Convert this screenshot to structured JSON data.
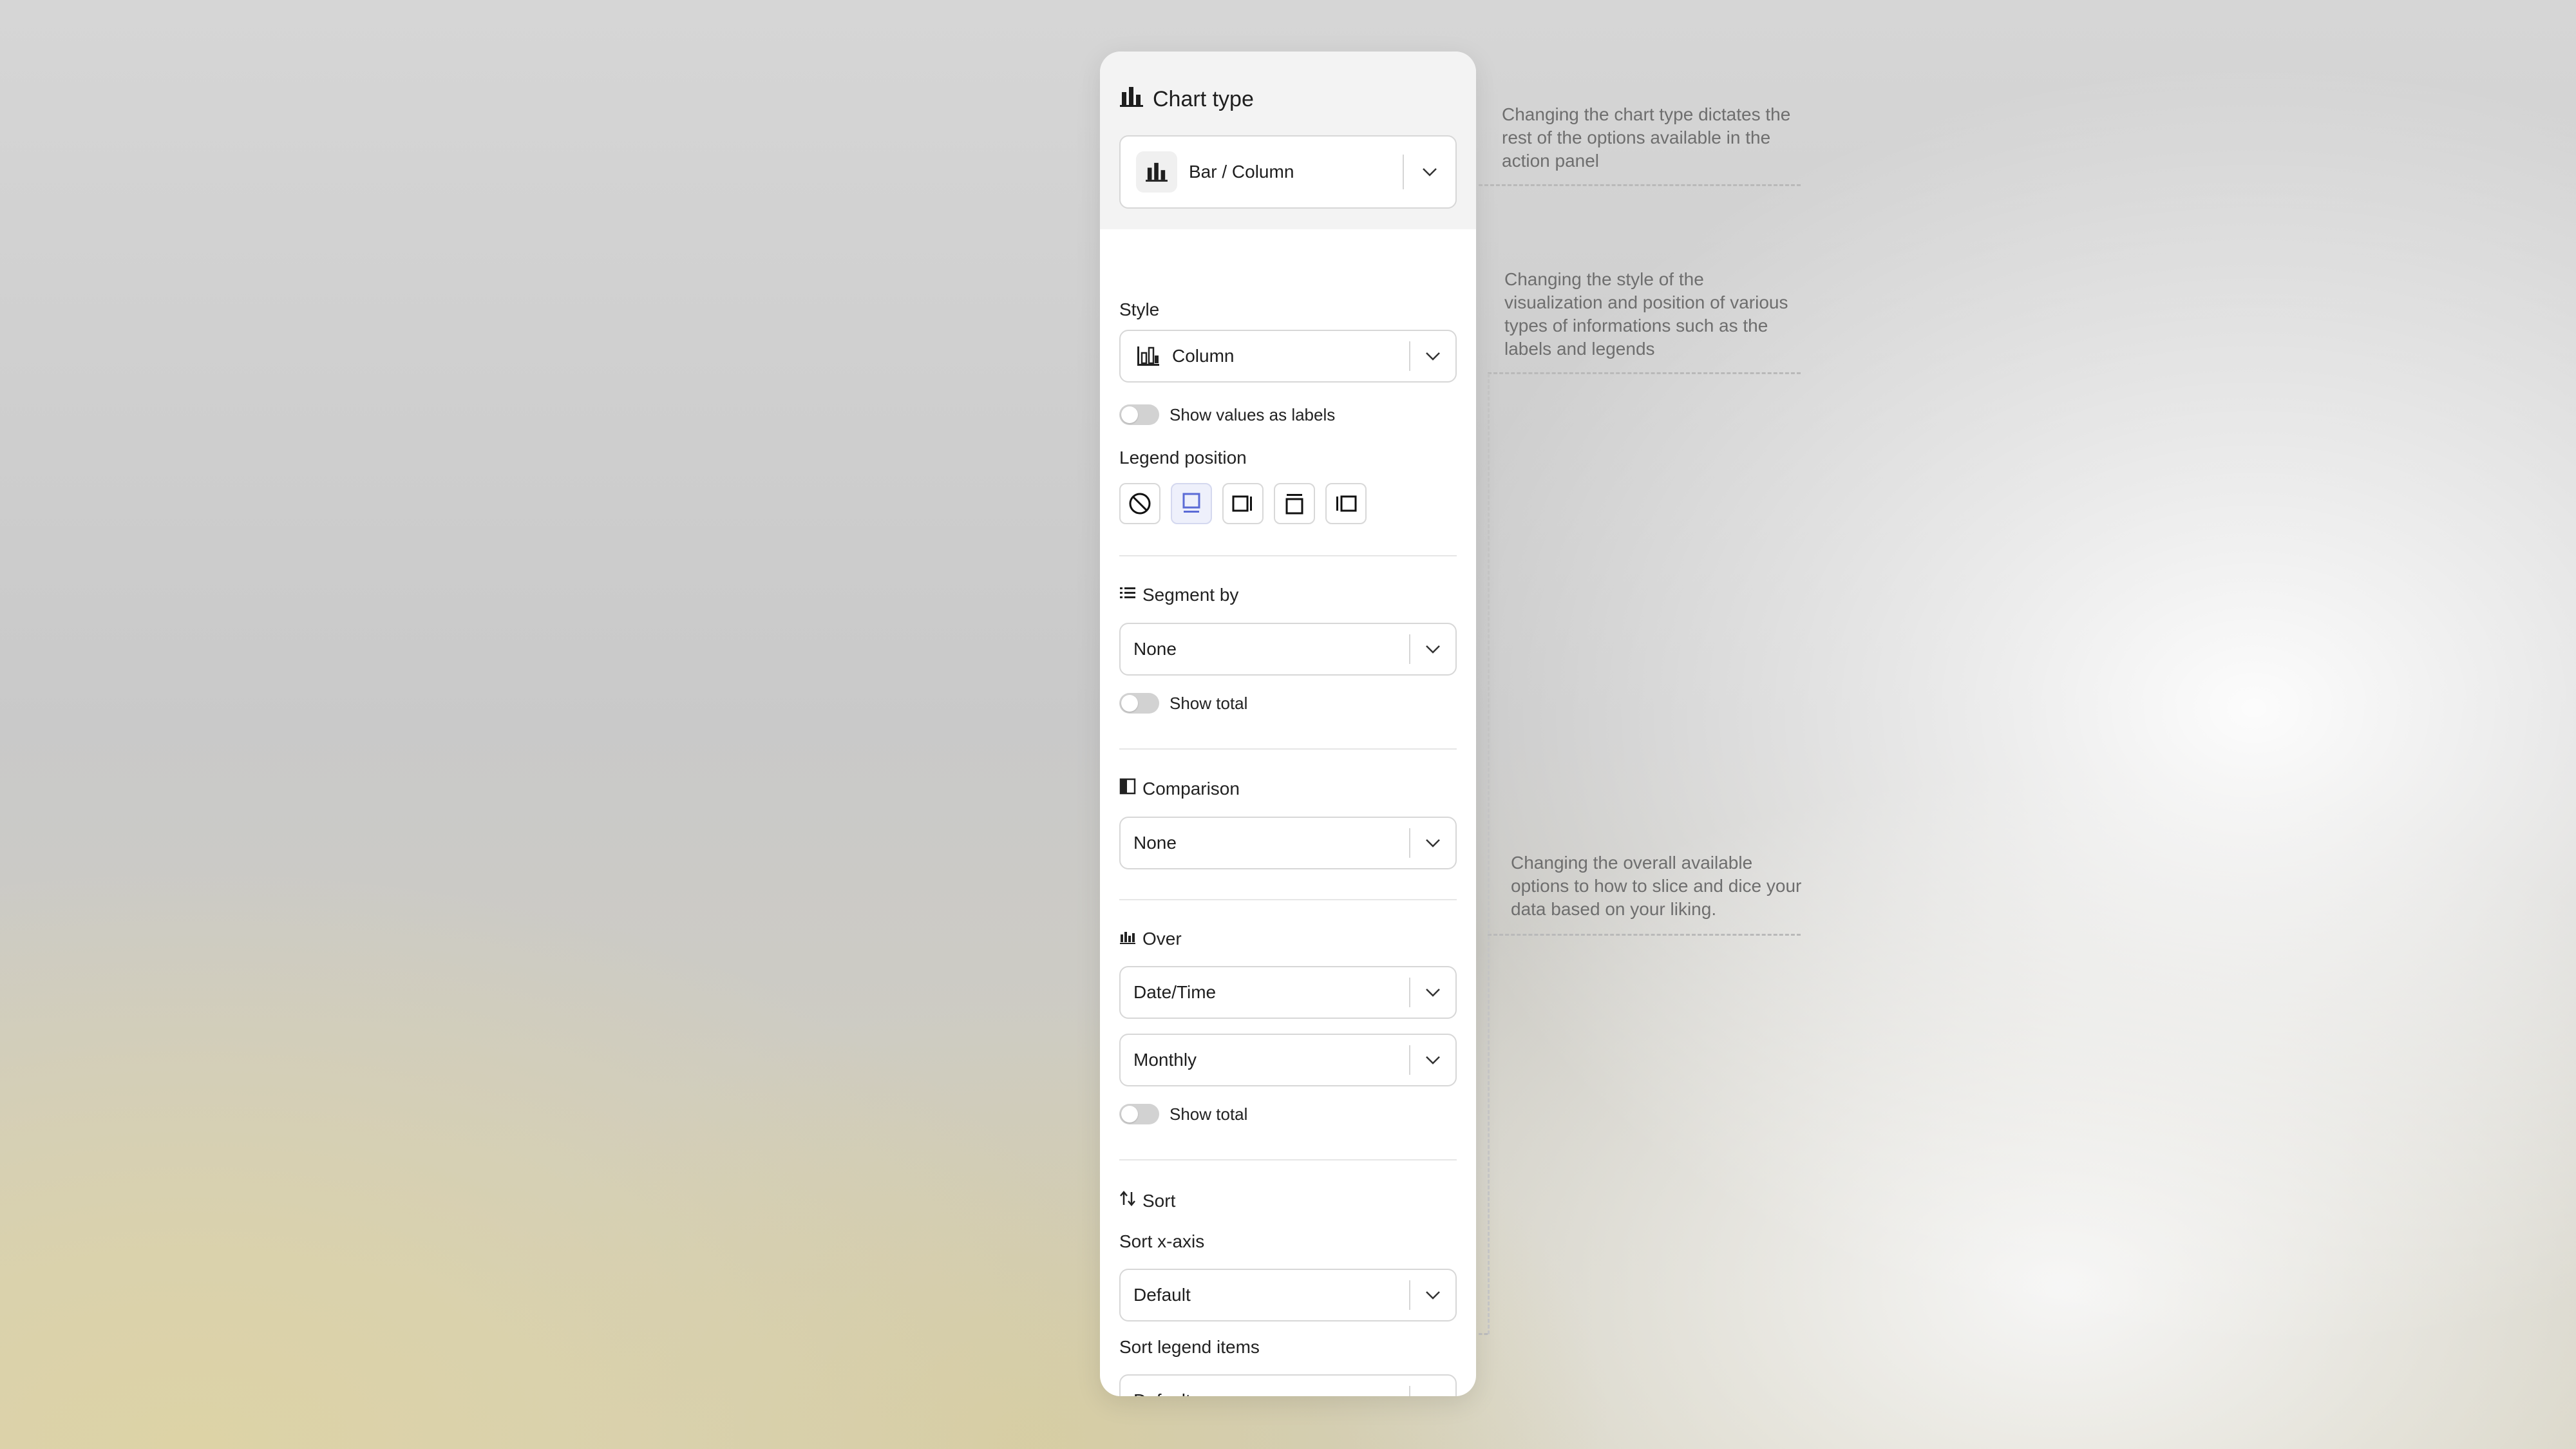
{
  "panel": {
    "chart_type": {
      "title": "Chart type",
      "value": "Bar / Column"
    },
    "style": {
      "label": "Style",
      "value": "Column",
      "show_values_label": "Show values as labels"
    },
    "legend_position": {
      "label": "Legend position",
      "options": [
        "none",
        "bottom",
        "right",
        "top",
        "left"
      ],
      "selected": "bottom",
      "accent_color": "#5b6bd6"
    },
    "segment_by": {
      "title": "Segment by",
      "value": "None",
      "show_total_label": "Show total"
    },
    "comparison": {
      "title": "Comparison",
      "value": "None"
    },
    "over": {
      "title": "Over",
      "value": "Date/Time",
      "interval": "Monthly",
      "show_total_label": "Show total"
    },
    "sort": {
      "title": "Sort",
      "x_axis_label": "Sort x-axis",
      "x_axis_value": "Default",
      "legend_label": "Sort legend items",
      "legend_value": "Default"
    }
  },
  "annotations": {
    "chart_type_note": "Changing the chart type dictates the rest of the options available in the action panel",
    "style_note": "Changing the style of the visualization and position of various types of informations such as the labels and legends",
    "options_note": "Changing the overall available options to how to slice and dice your data based on your liking."
  }
}
